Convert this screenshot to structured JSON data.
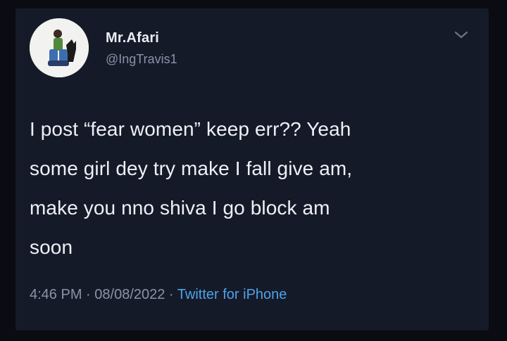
{
  "tweet": {
    "display_name": "Mr.Afari",
    "handle": "@IngTravis1",
    "text": "I post “fear women” keep err?? Yeah\nsome girl dey try make I fall give am,\nmake you nno shiva I go block am\nsoon",
    "time": "4:46 PM",
    "date": "08/08/2022",
    "separator": " · ",
    "source": "Twitter for iPhone"
  },
  "icons": {
    "avatar": "profile-photo",
    "menu": "chevron-down-icon"
  },
  "colors": {
    "background": "#151a29",
    "text": "#eef0f5",
    "secondary": "#8a93a6",
    "link": "#4ea3e8"
  }
}
